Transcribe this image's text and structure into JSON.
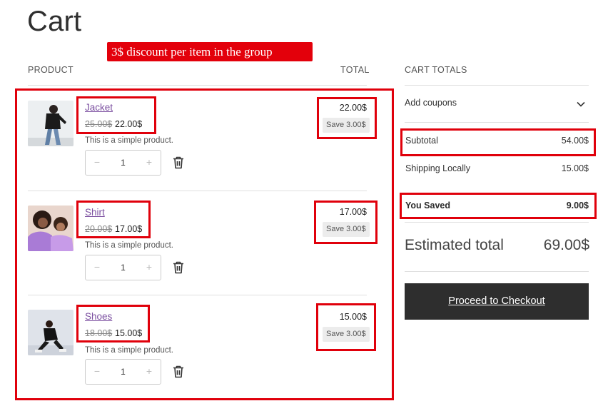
{
  "page": {
    "title": "Cart"
  },
  "annotation": {
    "text": "3$ discount per item in the group"
  },
  "table": {
    "col_product": "PRODUCT",
    "col_total": "TOTAL"
  },
  "items": [
    {
      "name": "Jacket",
      "old_price": "25.00$",
      "new_price": "22.00$",
      "description": "This is a simple product.",
      "qty": "1",
      "total": "22.00$",
      "save": "Save 3.00$"
    },
    {
      "name": "Shirt",
      "old_price": "20.00$",
      "new_price": "17.00$",
      "description": "This is a simple product.",
      "qty": "1",
      "total": "17.00$",
      "save": "Save 3.00$"
    },
    {
      "name": "Shoes",
      "old_price": "18.00$",
      "new_price": "15.00$",
      "description": "This is a simple product.",
      "qty": "1",
      "total": "15.00$",
      "save": "Save 3.00$"
    }
  ],
  "qty_controls": {
    "minus": "−",
    "plus": "+"
  },
  "totals": {
    "heading": "CART TOTALS",
    "coupons_label": "Add coupons",
    "subtotal_label": "Subtotal",
    "subtotal_value": "54.00$",
    "shipping_label": "Shipping Locally",
    "shipping_value": "15.00$",
    "saved_label": "You Saved",
    "saved_value": "9.00$",
    "estimated_label": "Estimated total",
    "estimated_value": "69.00$",
    "checkout_label": "Proceed to Checkout"
  },
  "colors": {
    "highlight": "#e0000b",
    "link": "#7b4fa0",
    "button": "#2e2e2e"
  },
  "icons": {
    "trash": "trash-icon",
    "chevron": "chevron-down-icon"
  }
}
